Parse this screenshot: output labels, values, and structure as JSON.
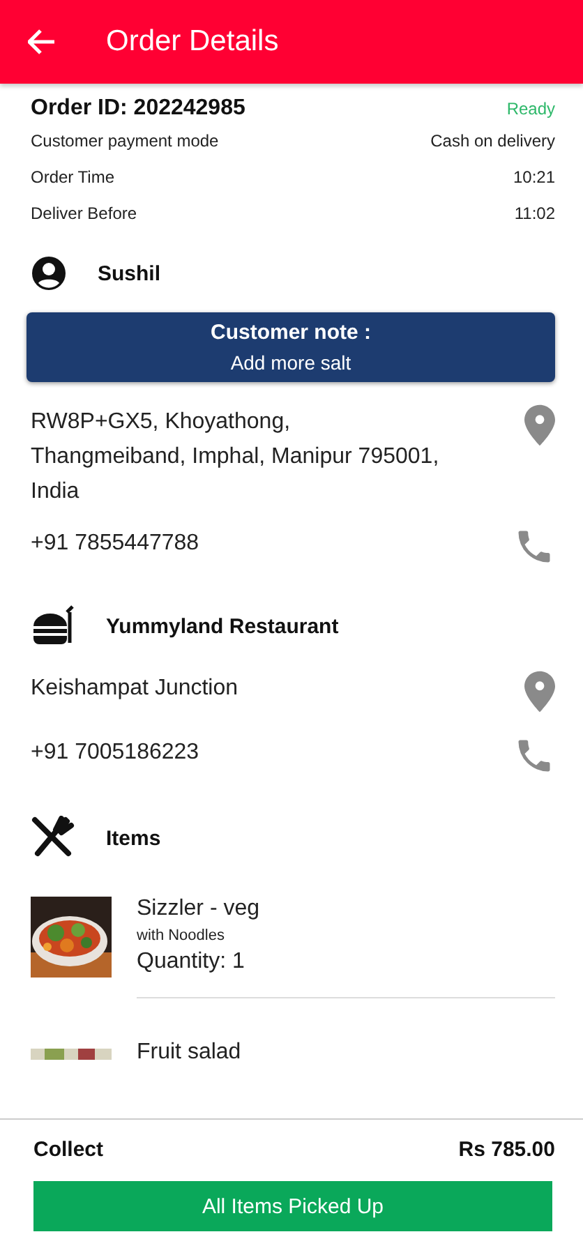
{
  "header": {
    "title": "Order Details"
  },
  "order": {
    "id_label": "Order ID: 202242985",
    "status": "Ready",
    "details": [
      {
        "label": "Customer payment mode",
        "value": "Cash on delivery"
      },
      {
        "label": "Order Time",
        "value": "10:21"
      },
      {
        "label": "Deliver Before",
        "value": "11:02"
      }
    ]
  },
  "customer": {
    "name": "Sushil",
    "note_title": "Customer note :",
    "note": "Add more salt",
    "address": "RW8P+GX5, Khoyathong, Thangmeiband, Imphal, Manipur 795001, India",
    "phone": "+91 7855447788"
  },
  "restaurant": {
    "name": "Yummyland Restaurant",
    "address": "Keishampat Junction",
    "phone": "+91 7005186223"
  },
  "items_title": "Items",
  "items": [
    {
      "name": "Sizzler - veg",
      "note": "with Noodles",
      "quantity": "Quantity: 1"
    },
    {
      "name": "Fruit salad"
    }
  ],
  "footer": {
    "collect_label": "Collect",
    "amount": "Rs 785.00",
    "button": "All Items Picked Up"
  }
}
